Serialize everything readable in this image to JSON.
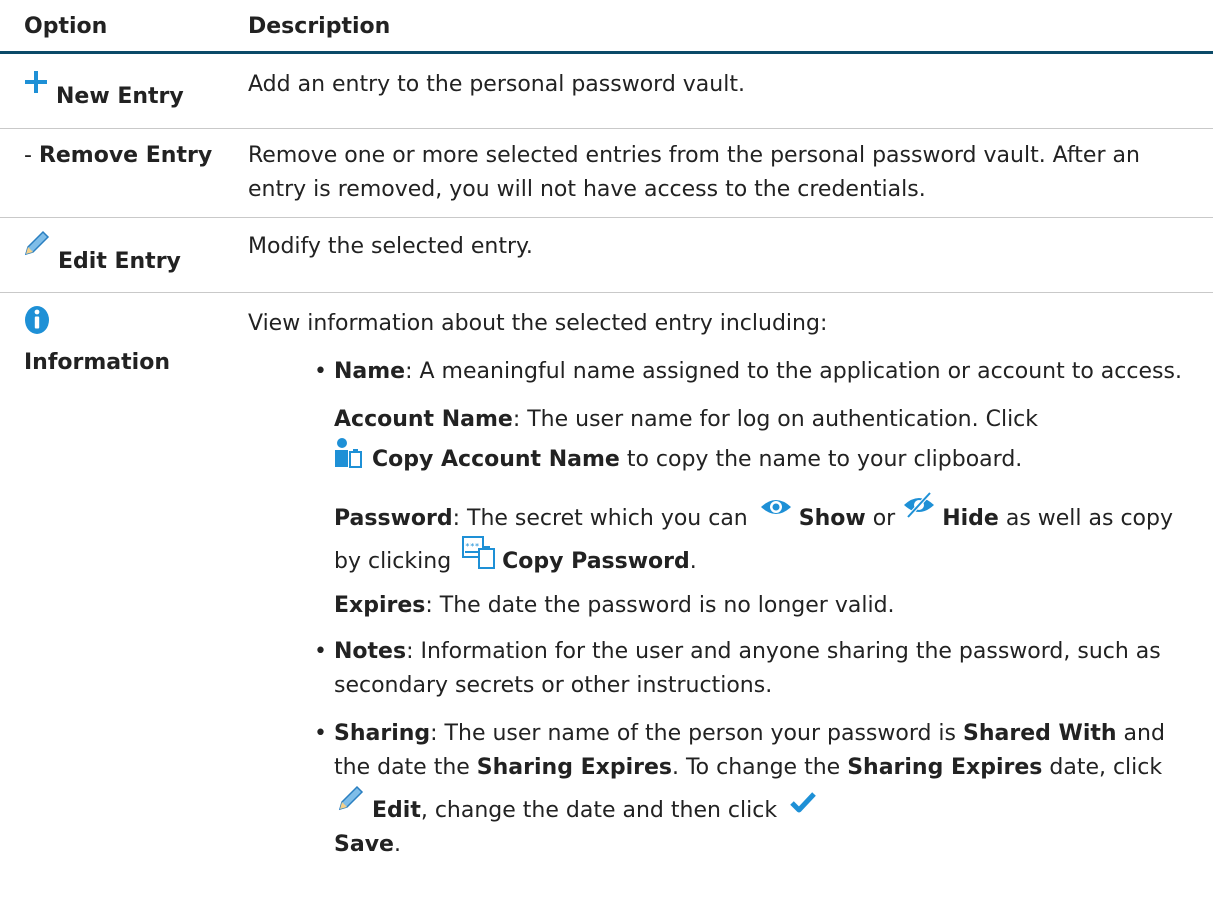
{
  "header": {
    "option": "Option",
    "description": "Description"
  },
  "rows": [
    {
      "option": "New Entry",
      "description": "Add an entry to the personal password vault."
    },
    {
      "option_prefix": "- ",
      "option": "Remove Entry",
      "description": "Remove one or more selected entries from the personal password vault. After an entry is removed, you will not have access to the credentials."
    },
    {
      "option": "Edit Entry",
      "description": "Modify the selected entry."
    },
    {
      "option": "Information",
      "description": "View information about the selected entry including:"
    }
  ],
  "info": {
    "name_label": "Name",
    "name_text": ": A meaningful name assigned to the application or account to access.",
    "account_label": "Account Name",
    "account_text": ": The user name for log on authentication. Click",
    "copy_account_label": "Copy Account Name",
    "copy_account_text": " to copy the name to your clipboard.",
    "password_label": "Password",
    "password_text": ": The secret which you can",
    "show_label": "Show",
    "or_text": " or ",
    "hide_label": "Hide",
    "as_text": " as well as copy by clicking",
    "copy_password_label": "Copy Password",
    "period": ".",
    "expires_label": "Expires",
    "expires_text": ": The date the password is no longer valid.",
    "notes_label": "Notes",
    "notes_text": ": Information for the user and anyone sharing the password, such as secondary secrets or other instructions.",
    "sharing_label": "Sharing",
    "sharing_text1": ": The user name of the person your password is ",
    "shared_with_label": "Shared With",
    "sharing_text2": " and the date the ",
    "sharing_expires_label": "Sharing Expires",
    "sharing_text3": ". To change the ",
    "sharing_expires_label2": "Sharing Expires",
    "sharing_text4": " date, click",
    "edit_label": "Edit",
    "sharing_text5": ", change the date and then click",
    "save_label": "Save",
    "save_period": "."
  },
  "icons": {
    "plus": "plus-icon",
    "pencil": "pencil-icon",
    "info": "info-icon",
    "copy_account": "copy-account-icon",
    "eye": "eye-icon",
    "eye_slash": "eye-slash-icon",
    "copy_password": "copy-password-icon",
    "check": "checkmark-icon"
  },
  "colors": {
    "accent": "#0b4a68",
    "icon_blue": "#1e90d6"
  }
}
